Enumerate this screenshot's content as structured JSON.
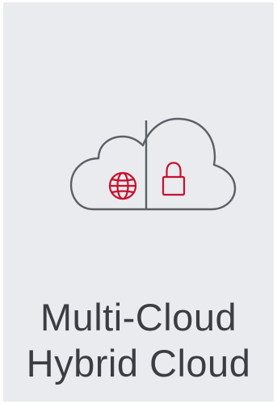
{
  "card": {
    "icon": "cloud-with-globe-and-lock-icon",
    "title_line_1": "Multi-Cloud",
    "title_line_2": "Hybrid Cloud"
  },
  "colors": {
    "background": "#e9ebee",
    "outline": "#5b6066",
    "accent": "#c8102e",
    "text": "#3a3d42"
  }
}
